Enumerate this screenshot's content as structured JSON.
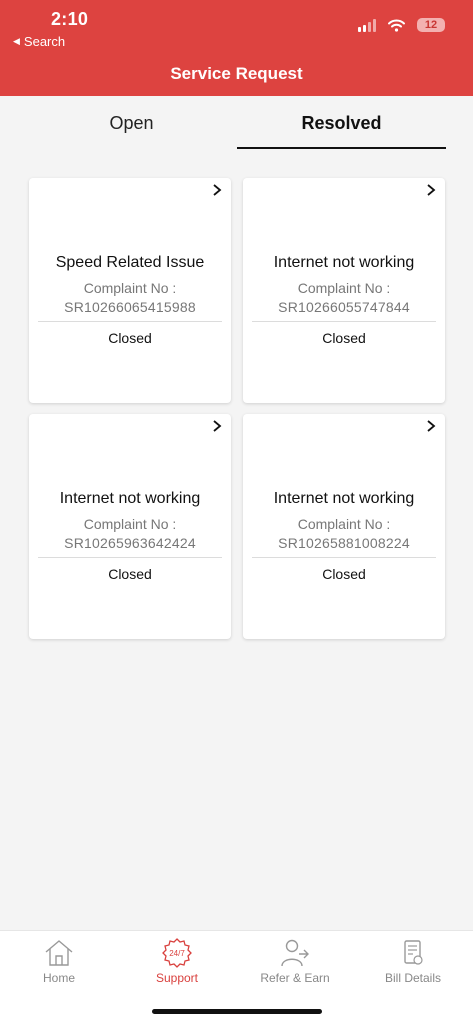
{
  "status_bar": {
    "time": "2:10",
    "back_label": "Search",
    "battery": "12"
  },
  "header": {
    "title": "Service Request"
  },
  "tabs": [
    {
      "label": "Open",
      "active": false
    },
    {
      "label": "Resolved",
      "active": true
    }
  ],
  "complaint_label": "Complaint No :",
  "cards": [
    {
      "title": "Speed Related Issue",
      "number": "SR10266065415988",
      "status": "Closed"
    },
    {
      "title": "Internet not working",
      "number": "SR10266055747844",
      "status": "Closed"
    },
    {
      "title": "Internet not working",
      "number": "SR10265963642424",
      "status": "Closed"
    },
    {
      "title": "Internet not working",
      "number": "SR10265881008224",
      "status": "Closed"
    }
  ],
  "bottom_nav": [
    {
      "label": "Home",
      "icon": "home-icon",
      "active": false
    },
    {
      "label": "Support",
      "icon": "support-24-7-icon",
      "active": true,
      "badge": "24/7"
    },
    {
      "label": "Refer & Earn",
      "icon": "refer-user-icon",
      "active": false
    },
    {
      "label": "Bill Details",
      "icon": "bill-icon",
      "active": false
    }
  ],
  "colors": {
    "brand_red": "#dd4340",
    "active_nav": "#d9413e",
    "muted_text": "#777777"
  }
}
